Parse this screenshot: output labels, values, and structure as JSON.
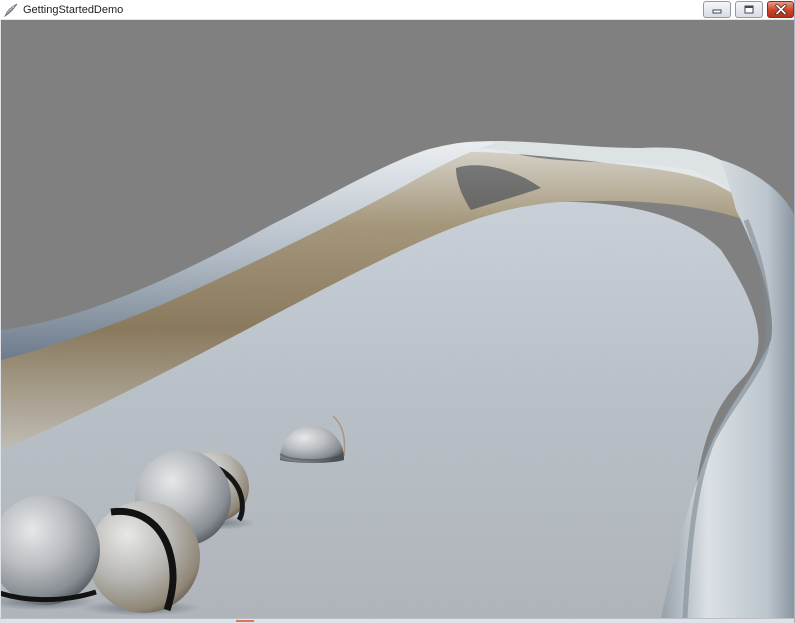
{
  "window": {
    "title": "GettingStartedDemo",
    "icon": "feather-app-icon",
    "controls": {
      "minimize": "minimize-icon",
      "maximize": "maximize-icon",
      "close": "close-icon"
    }
  },
  "scene": {
    "background_color": "#808080",
    "description_objects": [
      "terrain",
      "spheres"
    ]
  }
}
